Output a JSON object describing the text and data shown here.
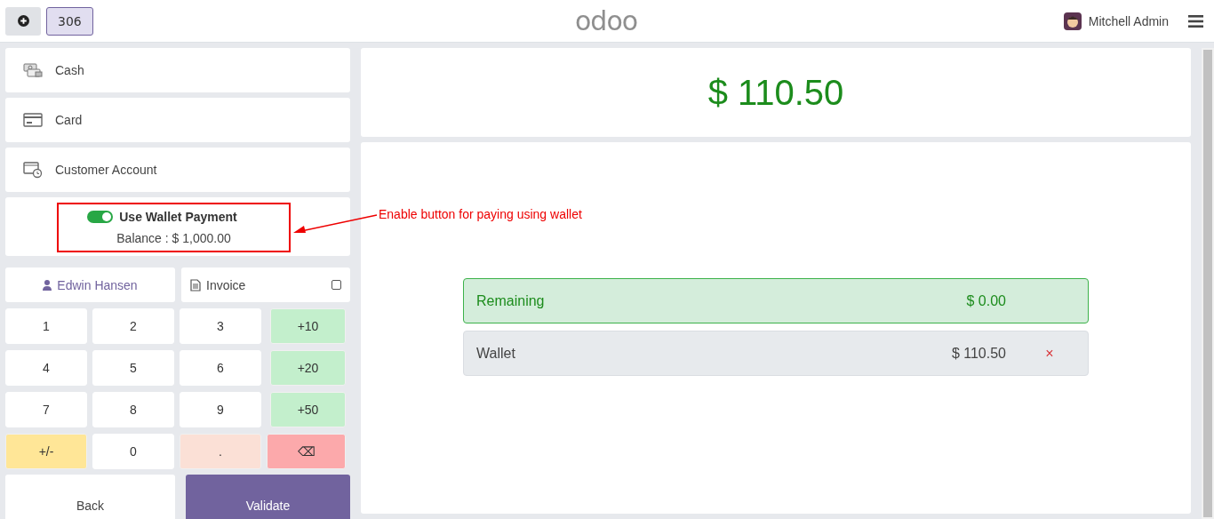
{
  "header": {
    "order_number": "306",
    "logo": "odoo",
    "user": "Mitchell Admin"
  },
  "payment_methods": [
    {
      "label": "Cash",
      "kind": "cash"
    },
    {
      "label": "Card",
      "kind": "card"
    },
    {
      "label": "Customer Account",
      "kind": "account"
    }
  ],
  "wallet": {
    "on": true,
    "label": "Use Wallet Payment",
    "balance": "Balance : $ 1,000.00"
  },
  "annotation": "Enable button for paying using wallet",
  "customer": "Edwin Hansen",
  "invoice": {
    "label": "Invoice",
    "checked": false
  },
  "keypad": [
    {
      "label": "1",
      "kind": "digit"
    },
    {
      "label": "2",
      "kind": "digit"
    },
    {
      "label": "3",
      "kind": "digit"
    },
    {
      "label": "+10",
      "kind": "add"
    },
    {
      "label": "4",
      "kind": "digit"
    },
    {
      "label": "5",
      "kind": "digit"
    },
    {
      "label": "6",
      "kind": "digit"
    },
    {
      "label": "+20",
      "kind": "add"
    },
    {
      "label": "7",
      "kind": "digit"
    },
    {
      "label": "8",
      "kind": "digit"
    },
    {
      "label": "9",
      "kind": "digit"
    },
    {
      "label": "+50",
      "kind": "add"
    },
    {
      "label": "+/-",
      "kind": "sign"
    },
    {
      "label": "0",
      "kind": "digit"
    },
    {
      "label": ".",
      "kind": "decimal"
    },
    {
      "label": "⌫",
      "kind": "backspace"
    }
  ],
  "actions": {
    "back": "Back",
    "validate": "Validate"
  },
  "total": "$ 110.50",
  "summary": {
    "label": "Remaining",
    "amount": "$ 0.00"
  },
  "payment_lines": [
    {
      "label": "Wallet",
      "amount": "$ 110.50",
      "remove": "×"
    }
  ]
}
